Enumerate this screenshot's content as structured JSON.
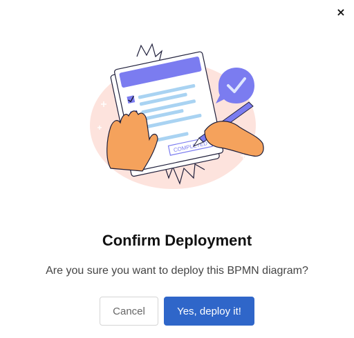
{
  "dialog": {
    "close_icon": "close-icon",
    "close_glyph": "×",
    "title": "Confirm Deployment",
    "message": "Are you sure you want to deploy this BPMN diagram?",
    "cancel_label": "Cancel",
    "confirm_label": "Yes, deploy it!"
  },
  "illustration": {
    "stamp_text": "COMPLETED",
    "colors": {
      "blob": "#fde3dd",
      "accent": "#7b7cf0",
      "line": "#a9d3f2",
      "skin": "#f5a25c",
      "ink": "#1e1e3a"
    }
  },
  "colors": {
    "primary": "#2f66c9",
    "cancel_border": "#d5d5d5"
  }
}
